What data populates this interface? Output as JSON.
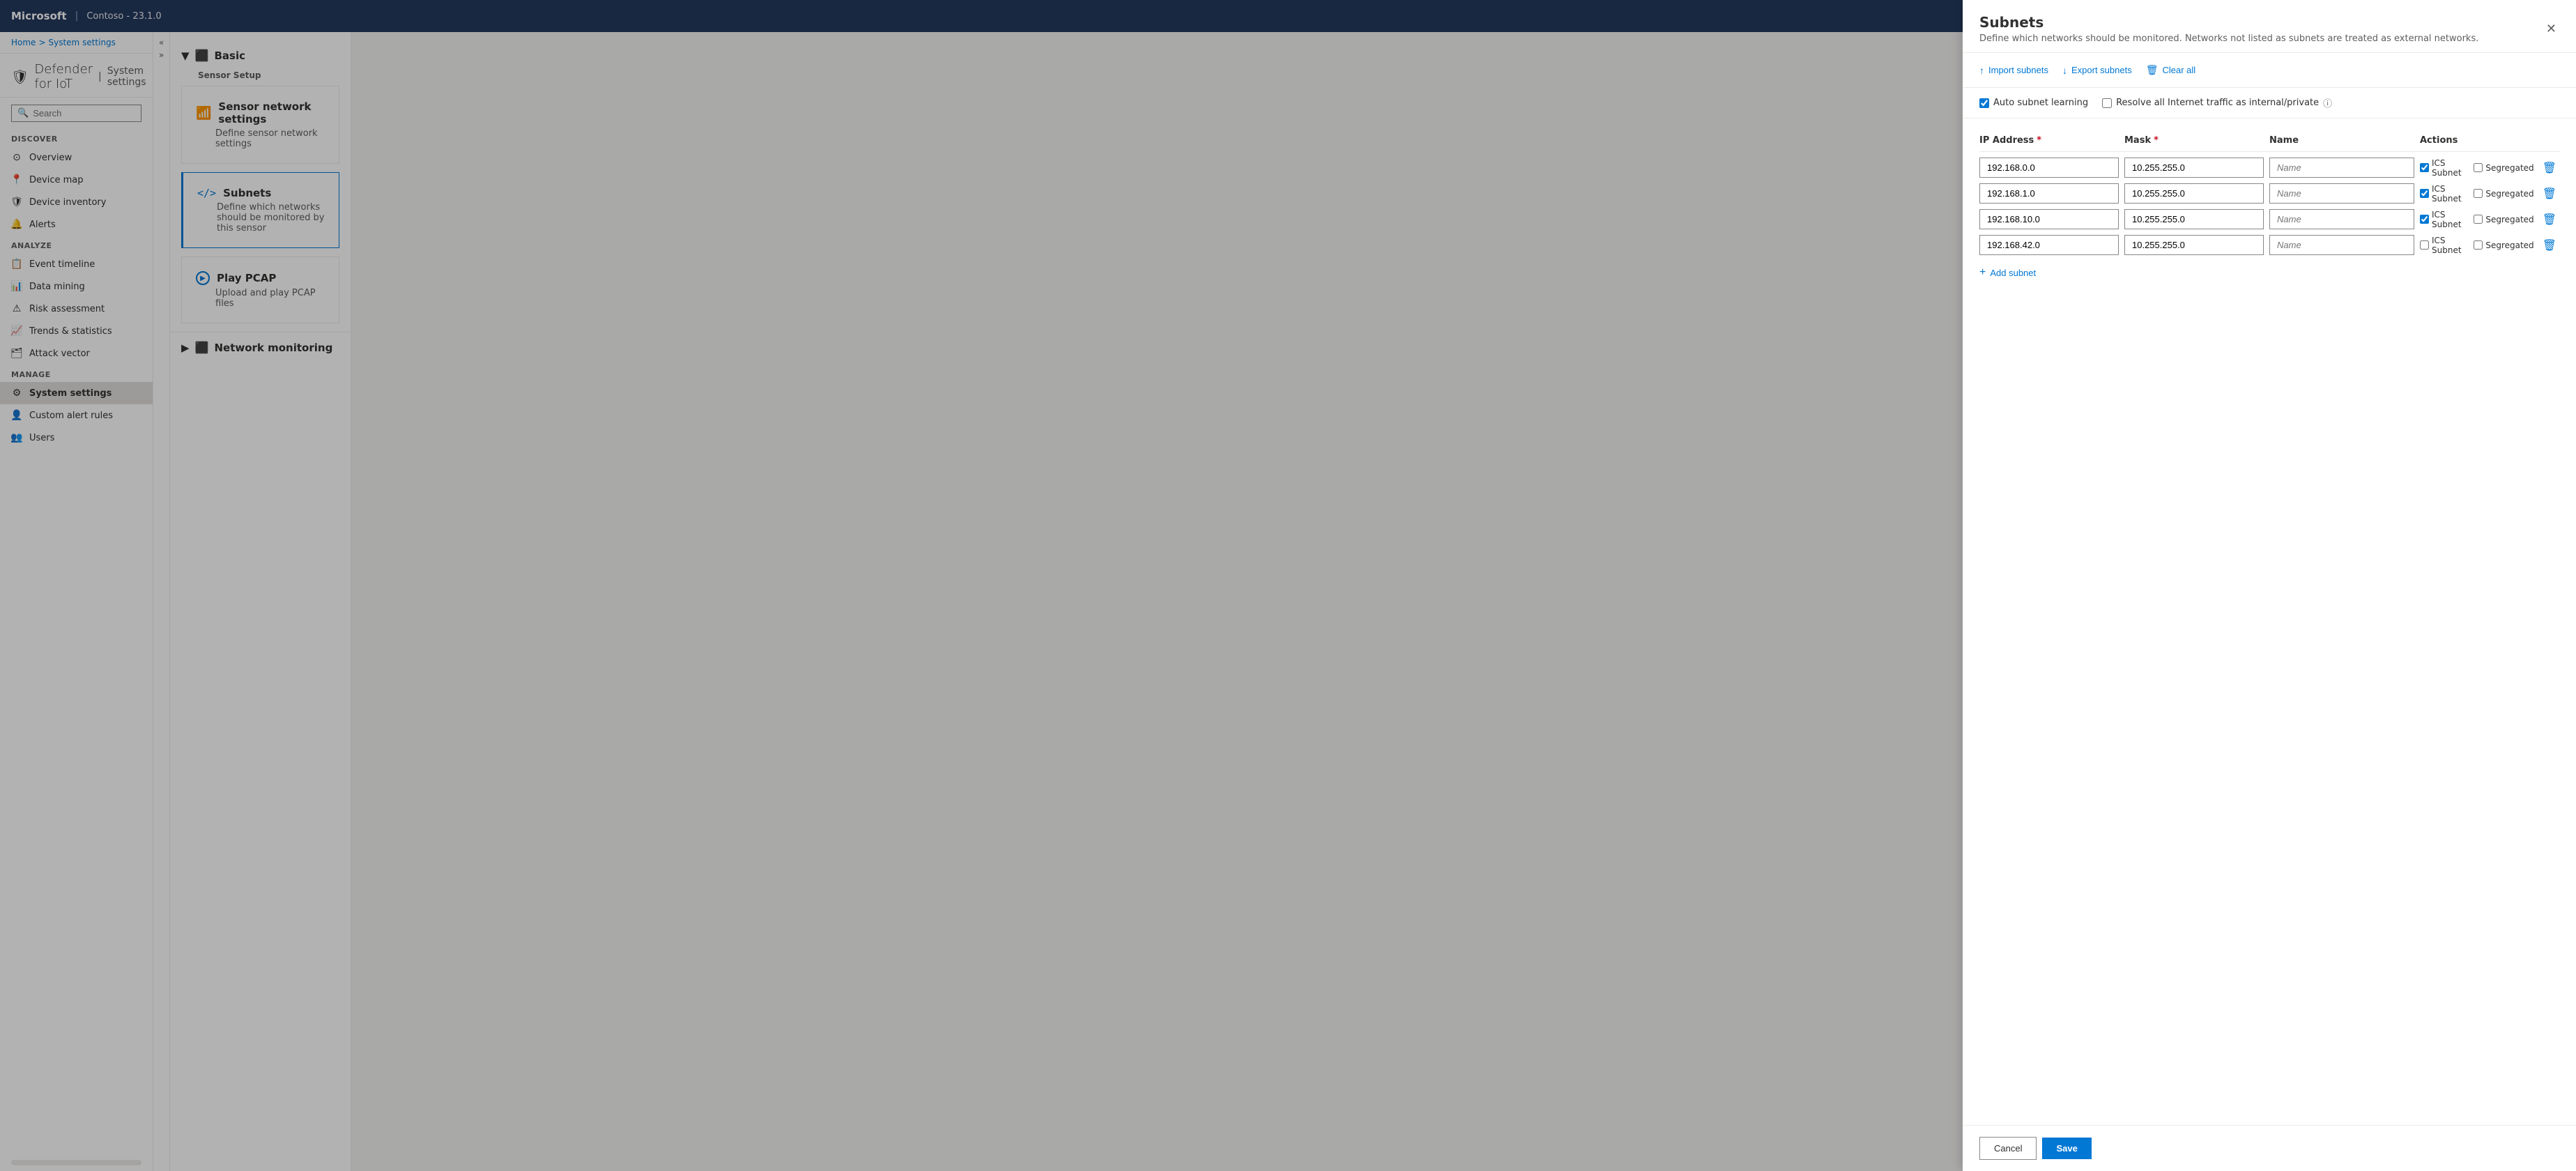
{
  "topbar": {
    "brand": "Microsoft",
    "separator": "|",
    "instance": "Contoso - 23.1.0"
  },
  "breadcrumb": {
    "home": "Home",
    "separator": ">",
    "current": "System settings"
  },
  "page_title": {
    "icon": "🛡",
    "brand": "Defender for IoT",
    "divider": "|",
    "section": "System settings"
  },
  "search": {
    "placeholder": "Search"
  },
  "sidebar": {
    "discover_label": "Discover",
    "items_discover": [
      {
        "id": "overview",
        "label": "Overview",
        "icon": "⊙"
      },
      {
        "id": "device-map",
        "label": "Device map",
        "icon": "📍"
      },
      {
        "id": "device-inventory",
        "label": "Device inventory",
        "icon": "🛡"
      },
      {
        "id": "alerts",
        "label": "Alerts",
        "icon": "🔔"
      }
    ],
    "analyze_label": "Analyze",
    "items_analyze": [
      {
        "id": "event-timeline",
        "label": "Event timeline",
        "icon": "📋"
      },
      {
        "id": "data-mining",
        "label": "Data mining",
        "icon": "📊"
      },
      {
        "id": "risk-assessment",
        "label": "Risk assessment",
        "icon": "⚠"
      },
      {
        "id": "trends-statistics",
        "label": "Trends & statistics",
        "icon": "📈"
      },
      {
        "id": "attack-vector",
        "label": "Attack vector",
        "icon": "🗂"
      }
    ],
    "manage_label": "Manage",
    "items_manage": [
      {
        "id": "system-settings",
        "label": "System settings",
        "icon": "⚙",
        "active": true
      },
      {
        "id": "custom-alert-rules",
        "label": "Custom alert rules",
        "icon": "👤"
      },
      {
        "id": "users",
        "label": "Users",
        "icon": "👥"
      }
    ]
  },
  "collapse_icons": {
    "up": "«",
    "down": "»",
    "expand": "▲",
    "collapse": "▼"
  },
  "settings": {
    "basic_section": {
      "label": "Basic",
      "chevron": "▼",
      "sensor_setup_label": "Sensor Setup"
    },
    "cards": [
      {
        "id": "sensor-network",
        "icon": "📶",
        "title": "Sensor network settings",
        "description": "Define sensor network settings"
      },
      {
        "id": "subnets",
        "icon": "</>",
        "title": "Subnets",
        "description": "Define which networks should be monitored by this sensor",
        "active": true
      },
      {
        "id": "play-pcap",
        "icon": "▶",
        "title": "Play PCAP",
        "description": "Upload and play PCAP files"
      }
    ],
    "network_monitoring": {
      "chevron": "▶",
      "label": "Network monitoring"
    }
  },
  "subnets_panel": {
    "title": "Subnets",
    "subtitle": "Define which networks should be monitored. Networks not listed as subnets are treated as external networks.",
    "toolbar": {
      "import_label": "Import subnets",
      "import_icon": "↑",
      "export_label": "Export subnets",
      "export_icon": "↓",
      "clear_label": "Clear all",
      "clear_icon": "🗑"
    },
    "options": {
      "auto_subnet_label": "Auto subnet learning",
      "auto_subnet_checked": true,
      "resolve_traffic_label": "Resolve all Internet traffic as internal/private",
      "resolve_traffic_checked": false
    },
    "table": {
      "col_ip": "IP Address",
      "col_mask": "Mask",
      "col_name": "Name",
      "col_actions": "Actions",
      "rows": [
        {
          "ip": "192.168.0.0",
          "mask": "10.255.255.0",
          "name": "",
          "name_placeholder": "Name",
          "ics_checked": true,
          "segregated_checked": false
        },
        {
          "ip": "192.168.1.0",
          "mask": "10.255.255.0",
          "name": "",
          "name_placeholder": "Name",
          "ics_checked": true,
          "segregated_checked": false
        },
        {
          "ip": "192.168.10.0",
          "mask": "10.255.255.0",
          "name": "",
          "name_placeholder": "Name",
          "ics_checked": true,
          "segregated_checked": false
        },
        {
          "ip": "192.168.42.0",
          "mask": "10.255.255.0",
          "name": "",
          "name_placeholder": "Name",
          "ics_checked": false,
          "segregated_checked": false
        }
      ]
    },
    "add_subnet_label": "Add subnet",
    "footer": {
      "cancel_label": "Cancel",
      "save_label": "Save"
    }
  }
}
